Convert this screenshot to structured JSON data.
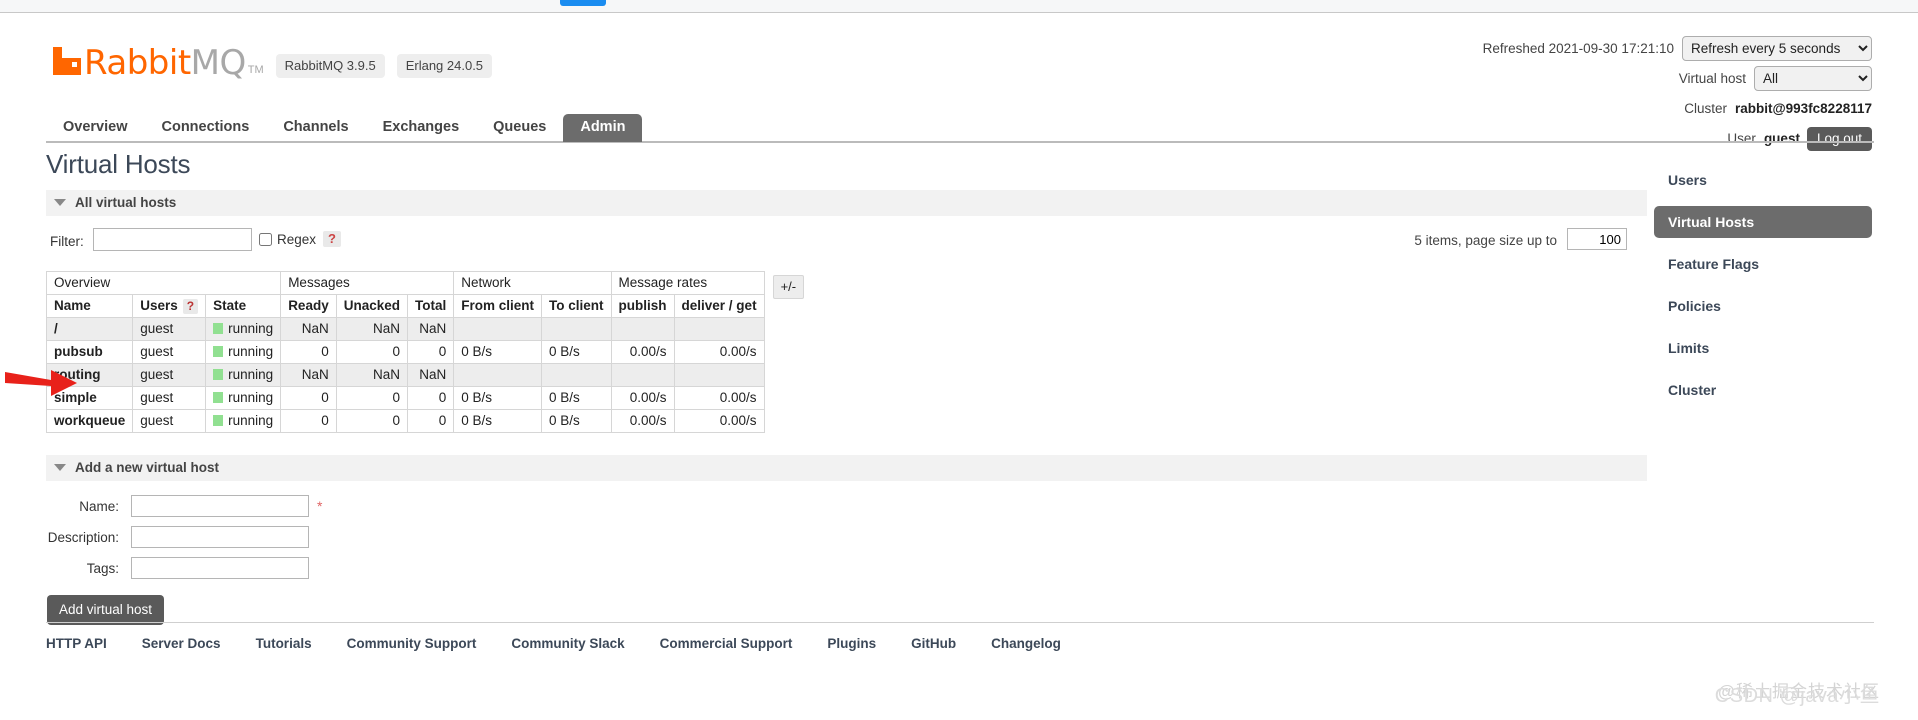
{
  "browser": {
    "tab_indicator": "active-tab"
  },
  "header": {
    "logo_primary": "Rabbit",
    "logo_secondary": "MQ",
    "logo_tm": "TM",
    "badges": [
      {
        "label": "RabbitMQ 3.9.5"
      },
      {
        "label": "Erlang 24.0.5"
      }
    ],
    "refreshed_label": "Refreshed 2021-09-30 17:21:10",
    "refresh_select": {
      "value": "Refresh every 5 seconds"
    },
    "vhost_label": "Virtual host",
    "vhost_select": {
      "value": "All"
    },
    "cluster_label": "Cluster",
    "cluster_value": "rabbit@993fc8228117",
    "user_label": "User",
    "user_value": "guest",
    "logout_label": "Log out"
  },
  "nav": {
    "tabs": [
      {
        "label": "Overview",
        "active": false
      },
      {
        "label": "Connections",
        "active": false
      },
      {
        "label": "Channels",
        "active": false
      },
      {
        "label": "Exchanges",
        "active": false
      },
      {
        "label": "Queues",
        "active": false
      },
      {
        "label": "Admin",
        "active": true
      }
    ]
  },
  "main": {
    "page_title": "Virtual Hosts",
    "all_vhosts_section": "All virtual hosts",
    "filter": {
      "label": "Filter:",
      "value": "",
      "regex_label": "Regex",
      "regex_checked": false,
      "help_label": "?"
    },
    "paging": {
      "items_text": "5 items, page size up to",
      "page_size": "100"
    },
    "table": {
      "group_headers": [
        {
          "label": "Overview",
          "span": 3
        },
        {
          "label": "Messages",
          "span": 3
        },
        {
          "label": "Network",
          "span": 2
        },
        {
          "label": "Message rates",
          "span": 2
        }
      ],
      "columns": [
        {
          "label": "Name",
          "align": "left"
        },
        {
          "label": "Users",
          "align": "left",
          "help": "?"
        },
        {
          "label": "State",
          "align": "left"
        },
        {
          "label": "Ready",
          "align": "right"
        },
        {
          "label": "Unacked",
          "align": "right"
        },
        {
          "label": "Total",
          "align": "right"
        },
        {
          "label": "From client",
          "align": "left"
        },
        {
          "label": "To client",
          "align": "left"
        },
        {
          "label": "publish",
          "align": "right"
        },
        {
          "label": "deliver / get",
          "align": "right"
        }
      ],
      "plusminus_label": "+/-",
      "rows": [
        {
          "name": "/",
          "users": "guest",
          "state": "running",
          "ready": "NaN",
          "unacked": "NaN",
          "total": "NaN",
          "from_client": "",
          "to_client": "",
          "publish": "",
          "deliver_get": ""
        },
        {
          "name": "pubsub",
          "users": "guest",
          "state": "running",
          "ready": "0",
          "unacked": "0",
          "total": "0",
          "from_client": "0 B/s",
          "to_client": "0 B/s",
          "publish": "0.00/s",
          "deliver_get": "0.00/s"
        },
        {
          "name": "routing",
          "users": "guest",
          "state": "running",
          "ready": "NaN",
          "unacked": "NaN",
          "total": "NaN",
          "from_client": "",
          "to_client": "",
          "publish": "",
          "deliver_get": ""
        },
        {
          "name": "simple",
          "users": "guest",
          "state": "running",
          "ready": "0",
          "unacked": "0",
          "total": "0",
          "from_client": "0 B/s",
          "to_client": "0 B/s",
          "publish": "0.00/s",
          "deliver_get": "0.00/s"
        },
        {
          "name": "workqueue",
          "users": "guest",
          "state": "running",
          "ready": "0",
          "unacked": "0",
          "total": "0",
          "from_client": "0 B/s",
          "to_client": "0 B/s",
          "publish": "0.00/s",
          "deliver_get": "0.00/s"
        }
      ]
    },
    "add_form": {
      "section_title": "Add a new virtual host",
      "fields": [
        {
          "label": "Name:",
          "value": "",
          "required": true
        },
        {
          "label": "Description:",
          "value": "",
          "required": false
        },
        {
          "label": "Tags:",
          "value": "",
          "required": false
        }
      ],
      "required_marker": "*",
      "submit_label": "Add virtual host"
    }
  },
  "sidebar": {
    "items": [
      {
        "label": "Users",
        "active": false
      },
      {
        "label": "Virtual Hosts",
        "active": true
      },
      {
        "label": "Feature Flags",
        "active": false
      },
      {
        "label": "Policies",
        "active": false
      },
      {
        "label": "Limits",
        "active": false
      },
      {
        "label": "Cluster",
        "active": false
      }
    ]
  },
  "footer": {
    "links": [
      {
        "label": "HTTP API"
      },
      {
        "label": "Server Docs"
      },
      {
        "label": "Tutorials"
      },
      {
        "label": "Community Support"
      },
      {
        "label": "Community Slack"
      },
      {
        "label": "Commercial Support"
      },
      {
        "label": "Plugins"
      },
      {
        "label": "GitHub"
      },
      {
        "label": "Changelog"
      }
    ]
  },
  "annotations": {
    "arrow_color": "#e8211a",
    "arrow_target": "routing",
    "watermark_top": "@稀土掘金技术社区",
    "watermark_bottom": "CSDN @java小鱼"
  },
  "colors": {
    "brand_orange": "#ff6600",
    "active_tab_gray": "#6c6c6c",
    "status_green": "#91e091",
    "title_slate": "#3c4858"
  }
}
